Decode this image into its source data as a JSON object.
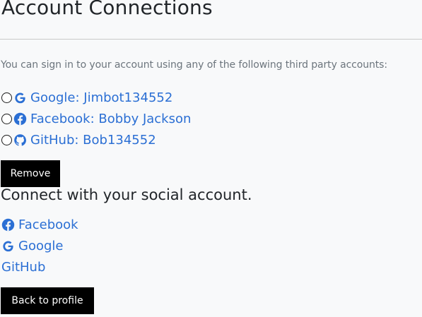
{
  "page": {
    "title": "Account Connections",
    "intro": "You can sign in to your account using any of the following third party accounts:"
  },
  "connected_accounts": [
    {
      "provider_icon": "google-icon",
      "label": "Google: Jimbot134552",
      "selected": false
    },
    {
      "provider_icon": "facebook-icon",
      "label": "Facebook: Bobby Jackson",
      "selected": false
    },
    {
      "provider_icon": "github-icon",
      "label": "GitHub: Bob134552",
      "selected": false
    }
  ],
  "actions": {
    "remove_label": "Remove",
    "back_label": "Back to profile"
  },
  "social": {
    "heading": "Connect with your social account.",
    "links": [
      {
        "icon": "facebook-icon",
        "label": "Facebook"
      },
      {
        "icon": "google-icon",
        "label": "Google"
      },
      {
        "icon": "",
        "label": "GitHub"
      }
    ]
  },
  "colors": {
    "link": "#2b6fd4",
    "button_bg": "#000000",
    "button_text": "#ffffff",
    "background": "#f8f9fa"
  }
}
